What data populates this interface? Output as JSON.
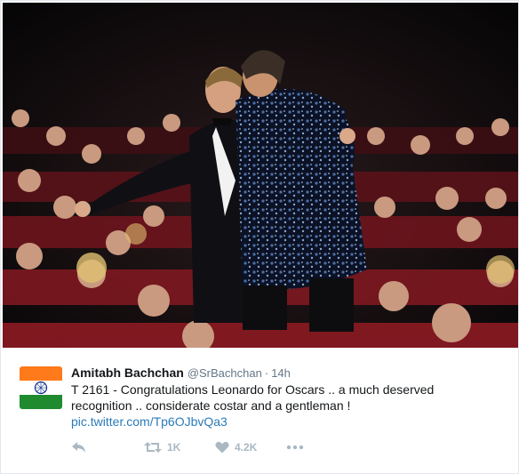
{
  "tweet": {
    "author_name": "Amitabh Bachchan",
    "handle": "@SrBachchan",
    "separator": "·",
    "time": "14h",
    "text": "T 2161 - Congratulations Leonardo for Oscars .. a much deserved recognition .. considerate costar and a gentleman !",
    "link": "pic.twitter.com/Tp6OJbvQa3"
  },
  "actions": {
    "reply_icon": "reply-arrow-icon",
    "retweet_icon": "retweet-icon",
    "retweet_count": "1K",
    "like_icon": "heart-icon",
    "like_count": "4.2K",
    "more_icon": "more-dots-icon"
  },
  "avatar": {
    "icon": "indian-flag-icon"
  },
  "colors": {
    "link": "#2b7bb9",
    "muted": "#657786",
    "action": "#aab8c2",
    "seat_red": "#8c1a22"
  }
}
